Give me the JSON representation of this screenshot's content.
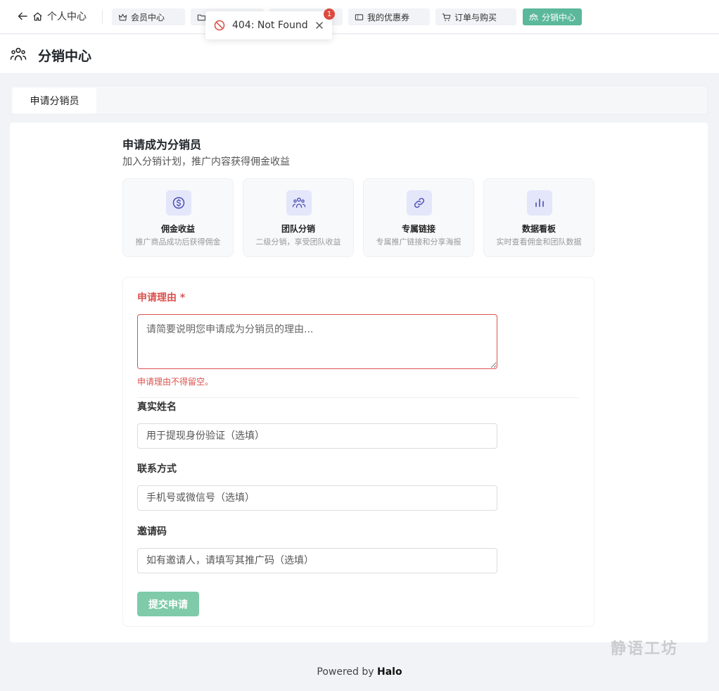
{
  "nav": {
    "home_label": "个人中心",
    "tabs": [
      {
        "label": "会员中心",
        "icon": "crown-icon"
      },
      {
        "label": "",
        "icon": "folder-icon"
      },
      {
        "label": "",
        "icon": ""
      },
      {
        "label": "我的优惠券",
        "icon": "ticket-icon"
      },
      {
        "label": "订单与购买",
        "icon": "cart-icon"
      },
      {
        "label": "分销中心",
        "icon": "users-icon",
        "active": true
      }
    ]
  },
  "toast": {
    "message": "404: Not Found",
    "badge_count": "1",
    "color": "#dc4a3f"
  },
  "header": {
    "title": "分销中心"
  },
  "section_tabs": [
    {
      "label": "申请分销员"
    }
  ],
  "apply": {
    "title": "申请成为分销员",
    "subtitle": "加入分销计划，推广内容获得佣金收益",
    "features": [
      {
        "icon": "coin-icon",
        "title": "佣金收益",
        "desc": "推广商品成功后获得佣金"
      },
      {
        "icon": "team-icon",
        "title": "团队分销",
        "desc": "二级分销，享受团队收益"
      },
      {
        "icon": "link-icon",
        "title": "专属链接",
        "desc": "专属推广链接和分享海报"
      },
      {
        "icon": "bar-chart-icon",
        "title": "数据看板",
        "desc": "实时查看佣金和团队数据"
      }
    ]
  },
  "form": {
    "reason": {
      "label": "申请理由 *",
      "placeholder": "请简要说明您申请成为分销员的理由...",
      "error": "申请理由不得留空。"
    },
    "real_name": {
      "label": "真实姓名",
      "placeholder": "用于提现身份验证（选填）"
    },
    "contact": {
      "label": "联系方式",
      "placeholder": "手机号或微信号（选填）"
    },
    "invite_code": {
      "label": "邀请码",
      "placeholder": "如有邀请人，请填写其推广码（选填）"
    },
    "submit_label": "提交申请"
  },
  "colors": {
    "accent": "#5bb89a",
    "error": "#d9534f",
    "icon_bg": "#e4e6fa"
  },
  "watermark": "静语工坊",
  "footer": {
    "prefix": "Powered by ",
    "brand": "Halo"
  }
}
